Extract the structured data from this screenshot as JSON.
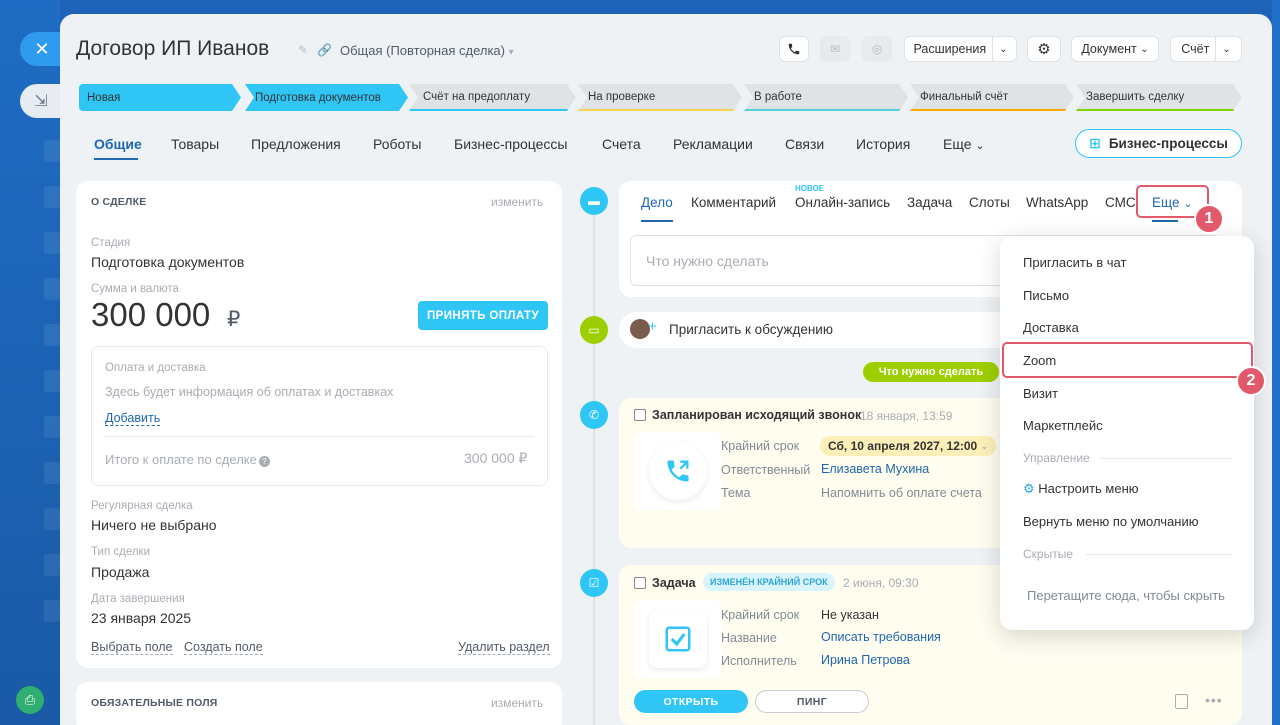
{
  "window": {
    "close_icon": "✕",
    "side_icon": "⇲",
    "bottom_icon": "⎙"
  },
  "header": {
    "title": "Договор ИП Иванов",
    "category": "Общая (Повторная сделка)",
    "extensions": "Расширения",
    "document": "Документ",
    "invoice": "Счёт"
  },
  "stages": [
    {
      "label": "Новая",
      "color": "#2fc6f6"
    },
    {
      "label": "Подготовка документов",
      "color": "#2fc6f6"
    },
    {
      "label": "Счёт на предоплату",
      "color": "#dfe3e6"
    },
    {
      "label": "На проверке",
      "color": "#dfe3e6"
    },
    {
      "label": "В работе",
      "color": "#dfe3e6"
    },
    {
      "label": "Финальный счёт",
      "color": "#dfe3e6"
    },
    {
      "label": "Завершить сделку",
      "color": "#dfe3e6"
    }
  ],
  "tabs": [
    "Общие",
    "Товары",
    "Предложения",
    "Роботы",
    "Бизнес-процессы",
    "Счета",
    "Рекламации",
    "Связи",
    "История",
    "Еще"
  ],
  "bp_button": "Бизнес-процессы",
  "about": {
    "title": "О СДЕЛКЕ",
    "edit": "изменить",
    "stage_label": "Стадия",
    "stage_value": "Подготовка документов",
    "sum_label": "Сумма и валюта",
    "sum_value": "300 000",
    "currency": "₽",
    "pay_button": "ПРИНЯТЬ ОПЛАТУ",
    "payment_title": "Оплата и доставка",
    "payment_info": "Здесь будет информация об оплатах и доставках",
    "add": "Добавить",
    "total_label": "Итого к оплате по сделке",
    "total_value": "300 000 ₽",
    "regular_label": "Регулярная сделка",
    "regular_value": "Ничего не выбрано",
    "type_label": "Тип сделки",
    "type_value": "Продажа",
    "close_label": "Дата завершения",
    "close_value": "23 января 2025",
    "select_field": "Выбрать поле",
    "create_field": "Создать поле",
    "delete_section": "Удалить раздел"
  },
  "required": {
    "title": "ОБЯЗАТЕЛЬНЫЕ ПОЛЯ",
    "edit": "изменить"
  },
  "composer": {
    "tabs": [
      "Дело",
      "Комментарий",
      "Онлайн-запись",
      "Задача",
      "Слоты",
      "WhatsApp",
      "СМС",
      "Еще"
    ],
    "new_badge": "НОВОЕ",
    "placeholder": "Что нужно сделать"
  },
  "invite": "Пригласить к обсуждению",
  "todo_pill": "Что нужно сделать",
  "call": {
    "title": "Запланирован исходящий звонок",
    "time": "18 января, 13:59",
    "deadline_k": "Крайний срок",
    "deadline_v": "Сб, 10 апреля 2027, 12:00",
    "resp_k": "Ответственный",
    "resp_v": "Елизавета Мухина",
    "topic_k": "Тема",
    "topic_v": "Напомнить об оплате счета"
  },
  "task": {
    "title": "Задача",
    "badge": "ИЗМЕНЁН КРАЙНИЙ СРОК",
    "time": "2 июня, 09:30",
    "deadline_k": "Крайний срок",
    "deadline_v": "Не указан",
    "name_k": "Название",
    "name_v": "Описать требования",
    "exec_k": "Исполнитель",
    "exec_v": "Ирина Петрова",
    "open": "ОТКРЫТЬ",
    "ping": "ПИНГ"
  },
  "menu": {
    "items": [
      "Пригласить в чат",
      "Письмо",
      "Доставка",
      "Zoom",
      "Визит",
      "Маркетплейс"
    ],
    "section_manage": "Управление",
    "configure": "Настроить меню",
    "reset": "Вернуть меню по умолчанию",
    "section_hidden": "Скрытые",
    "drag_hint": "Перетащите сюда, чтобы скрыть"
  },
  "annotations": {
    "one": "1",
    "two": "2"
  },
  "colors": {
    "accent": "#2067b0",
    "cyan": "#2fc6f6",
    "green": "#9dcf00",
    "highlight": "#e2596b"
  }
}
